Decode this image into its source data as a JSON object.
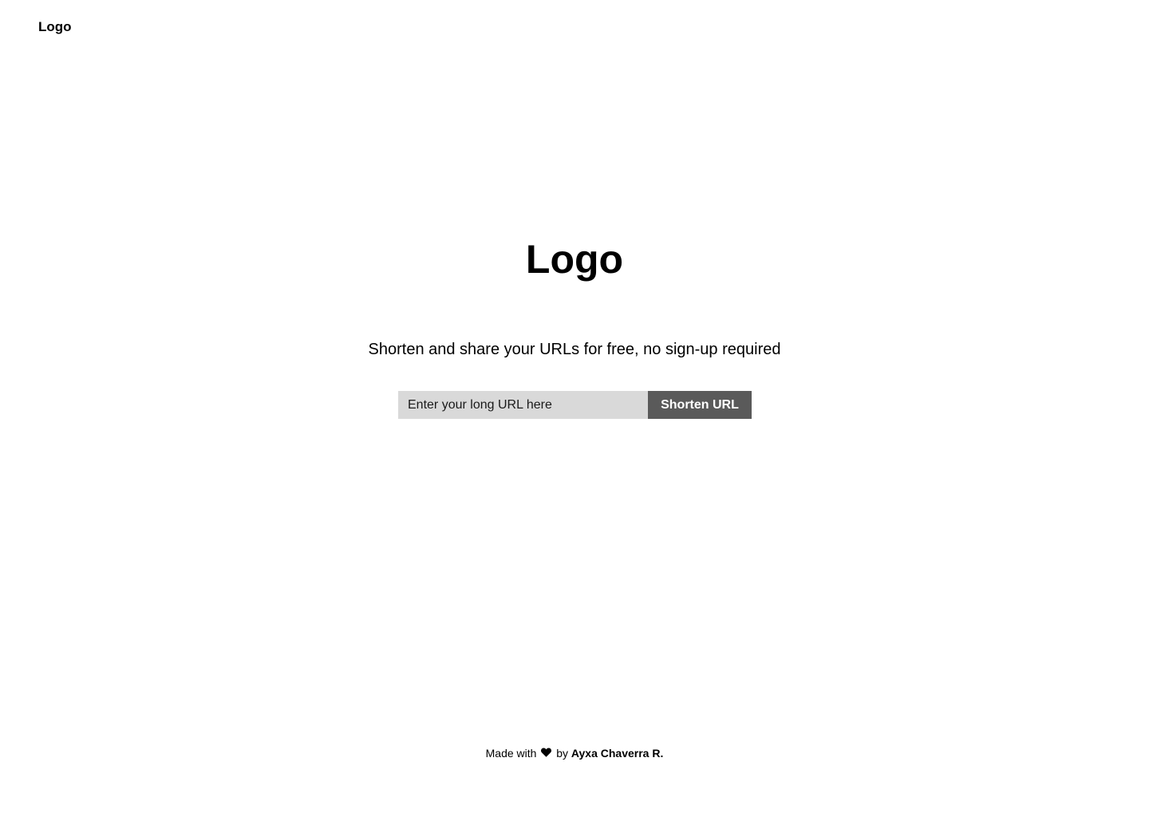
{
  "header": {
    "logo": "Logo"
  },
  "hero": {
    "logo": "Logo",
    "tagline": "Shorten and share your URLs for free, no sign-up required"
  },
  "form": {
    "input_placeholder": "Enter your long URL here",
    "button_label": "Shorten URL"
  },
  "footer": {
    "prefix": "Made with",
    "heart_icon": "heart-icon",
    "middle": "by",
    "author": "Ayxa Chaverra R."
  },
  "colors": {
    "background": "#ffffff",
    "input_background": "#d9d9d9",
    "button_background": "#5a5a5a",
    "button_text": "#ffffff",
    "text": "#000000"
  }
}
